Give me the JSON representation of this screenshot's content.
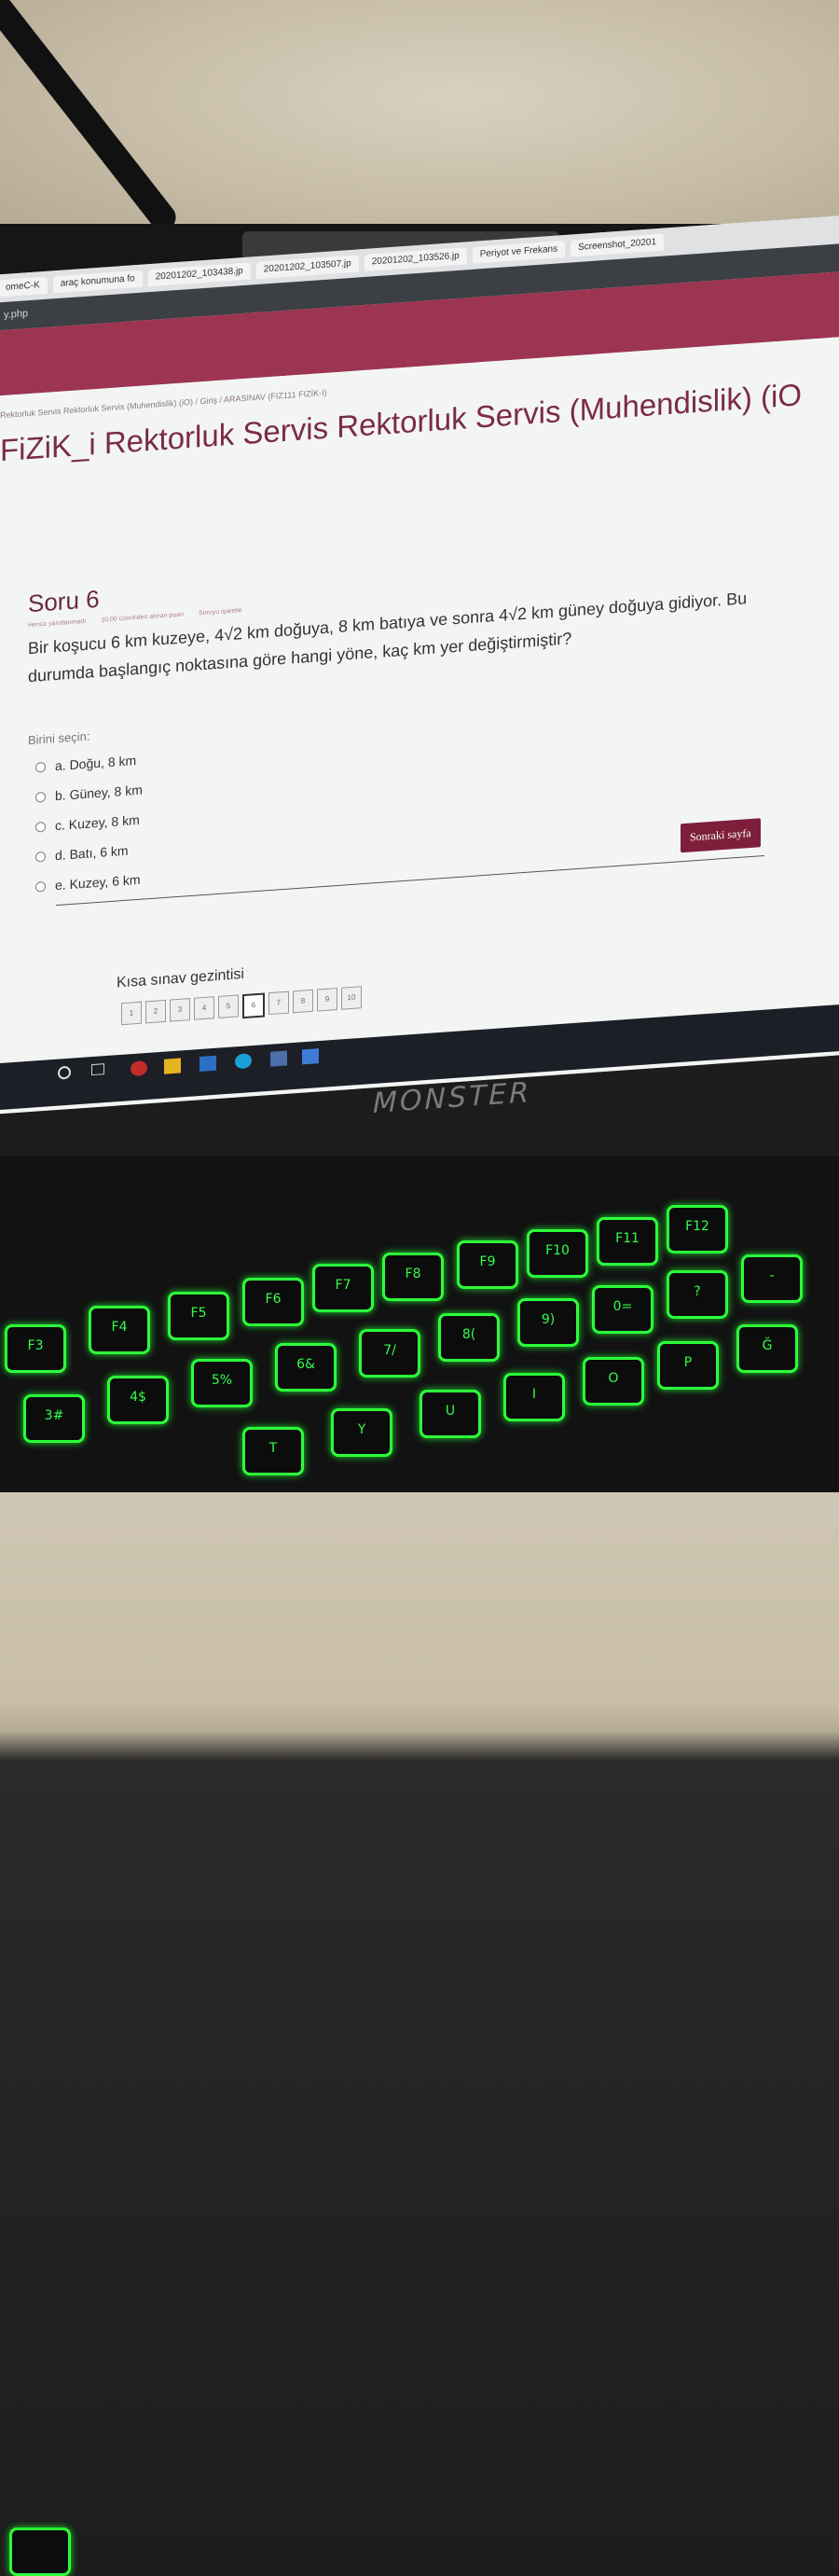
{
  "browser": {
    "tabs": [
      "omeC-K",
      "araç konumuna fo",
      "20201202_103438.jp",
      "20201202_103507.jp",
      "20201202_103526.jp",
      "Periyot ve Frekans",
      "Screenshot_20201"
    ],
    "url_fragment": "y.php"
  },
  "breadcrumb": "Rektorluk Servis Rektorluk Servis (Muhendislik) (iO) / Giriş / ARASINAV (FIZ111 FIZİK-I)",
  "course_title": "FiZiK_i Rektorluk Servis Rektorluk Servis (Muhendislik) (iO",
  "question": {
    "number_label": "Soru 6",
    "status": "Henüz yanıtlanmadı",
    "points": "10,00 üzerinden alınan puan",
    "flag": "Soruyu işaretle",
    "text": "Bir koşucu 6 km kuzeye, 4√2 km doğuya, 8 km batıya ve sonra 4√2 km güney doğuya gidiyor. Bu durumda başlangıç noktasına göre hangi yöne, kaç km yer değiştirmiştir?",
    "select_prompt": "Birini seçin:",
    "options": [
      "a. Doğu, 8 km",
      "b. Güney, 8 km",
      "c. Kuzey, 8 km",
      "d. Batı, 6 km",
      "e. Kuzey, 6 km"
    ]
  },
  "next_button": "Sonraki sayfa",
  "quiz_nav": {
    "title": "Kısa sınav gezintisi",
    "pages": [
      "1",
      "2",
      "3",
      "4",
      "5",
      "6",
      "7",
      "8",
      "9",
      "10"
    ],
    "current": "6"
  },
  "laptop_logo": "MONSTER",
  "keys": {
    "row1": [
      "F3",
      "F4",
      "F5",
      "F6",
      "F7",
      "F8",
      "F9",
      "F10",
      "F11",
      "F12"
    ],
    "row2": [
      "3#",
      "4$",
      "5%",
      "6&",
      "7/",
      "8(",
      "9)",
      "0=",
      "?",
      "-"
    ],
    "row3": [
      "T",
      "Y",
      "U",
      "I",
      "O",
      "P",
      "Ğ"
    ]
  }
}
